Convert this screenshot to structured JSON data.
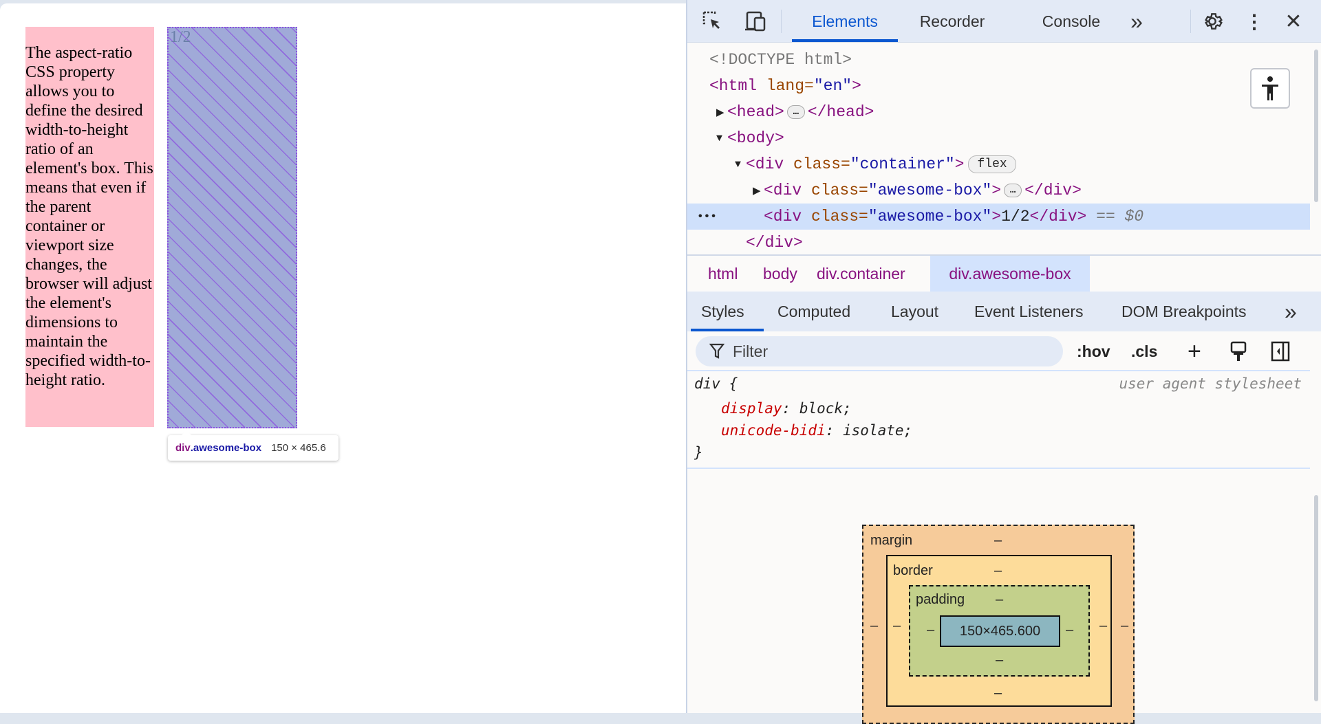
{
  "page": {
    "paragraph": "The aspect-ratio CSS property allows you to define the desired width-to-height ratio of an element's box. This means that even if the parent container or viewport size changes, the browser will adjust the element's dimensions to maintain the specified width-to-height ratio.",
    "box_text": "1/2",
    "tooltip": {
      "tag": "div",
      "class": ".awesome-box",
      "size": "150 × 465.6"
    }
  },
  "devtools": {
    "toolbar": {
      "tabs": [
        "Elements",
        "Recorder",
        "Console"
      ],
      "active_tab": "Elements",
      "more": "»",
      "icons": [
        "inspect-element-icon",
        "device-toolbar-icon",
        "settings-gear-icon",
        "kebab-menu-icon",
        "close-icon"
      ]
    },
    "dom_tree": {
      "doctype": "<!DOCTYPE html>",
      "html_open": {
        "tag": "<html",
        "attr": " lang=",
        "val": "\"en\"",
        "close": ">"
      },
      "head": {
        "open": "<head>",
        "close": "</head>",
        "ellipsis": "…"
      },
      "body": "<body>",
      "container": {
        "tag": "<div",
        "attr": " class=",
        "val": "\"container\"",
        "close": ">",
        "badge": "flex"
      },
      "box1": {
        "tag": "<div",
        "attr": " class=",
        "val": "\"awesome-box\"",
        "close": ">",
        "end": "</div>",
        "ellipsis": "…"
      },
      "box2": {
        "tag": "<div",
        "attr": " class=",
        "val": "\"awesome-box\"",
        "close": ">",
        "text": "1/2",
        "end": "</div>",
        "ref": " == $0"
      },
      "div_close": "</div>",
      "row_menu": "•••"
    },
    "breadcrumbs": [
      "html",
      "body",
      "div.container",
      "div.awesome-box"
    ],
    "styles_tabs": [
      "Styles",
      "Computed",
      "Layout",
      "Event Listeners",
      "DOM Breakpoints"
    ],
    "styles_more": "»",
    "filter": {
      "placeholder": "Filter",
      "hov": ":hov",
      "cls": ".cls"
    },
    "rule": {
      "selector": "div {",
      "source": "user agent stylesheet",
      "decls": [
        {
          "prop": "display",
          "value": "block"
        },
        {
          "prop": "unicode-bidi",
          "value": "isolate"
        }
      ],
      "close": "}"
    },
    "box_model": {
      "margin_label": "margin",
      "border_label": "border",
      "padding_label": "padding",
      "content": "150×465.600",
      "empty": "–",
      "colors": {
        "margin": "#f6cb9a",
        "border": "#fddc9a",
        "padding": "#c3d08b",
        "content": "#8cb6c0"
      }
    }
  }
}
